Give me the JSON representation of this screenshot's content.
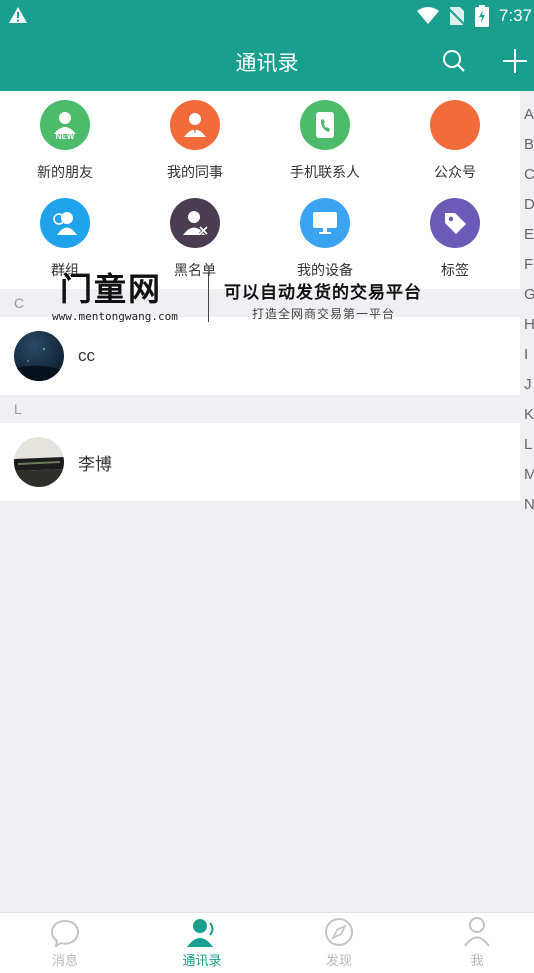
{
  "status_bar": {
    "time": "7:37"
  },
  "header": {
    "title": "通讯录"
  },
  "shortcuts": [
    {
      "label": "新的朋友",
      "color": "#4cbb6a",
      "icon": "new-friend-icon",
      "badge": "NEW"
    },
    {
      "label": "我的同事",
      "color": "#f26b3a",
      "icon": "colleague-icon"
    },
    {
      "label": "手机联系人",
      "color": "#4cbb6a",
      "icon": "phone-contacts-icon"
    },
    {
      "label": "公众号",
      "color": "#f26b3a",
      "icon": "official-account-icon"
    },
    {
      "label": "群组",
      "color": "#21a3ec",
      "icon": "group-icon"
    },
    {
      "label": "黑名单",
      "color": "#4a3d52",
      "icon": "blacklist-icon"
    },
    {
      "label": "我的设备",
      "color": "#3aa3f2",
      "icon": "device-icon"
    },
    {
      "label": "标签",
      "color": "#6b5bb6",
      "icon": "tag-icon"
    }
  ],
  "sections": [
    {
      "letter": "C",
      "contacts": [
        {
          "name": "cc"
        }
      ]
    },
    {
      "letter": "L",
      "contacts": [
        {
          "name": "李博"
        }
      ]
    }
  ],
  "index_letters": [
    "A",
    "B",
    "C",
    "D",
    "E",
    "F",
    "G",
    "H",
    "I",
    "J",
    "K",
    "L",
    "M",
    "N"
  ],
  "watermark": {
    "brand": "门童网",
    "url": "www.mentongwang.com",
    "slogan": "可以自动发货的交易平台",
    "slogan_sub": "打造全网商交易第一平台"
  },
  "tabs": [
    {
      "label": "消息",
      "icon": "chat-bubble-icon",
      "active": false
    },
    {
      "label": "通讯录",
      "icon": "contacts-icon",
      "active": true
    },
    {
      "label": "发现",
      "icon": "compass-icon",
      "active": false
    },
    {
      "label": "我",
      "icon": "person-icon",
      "active": false
    }
  ],
  "colors": {
    "primary": "#1a9e8d",
    "background": "#efeff4"
  }
}
